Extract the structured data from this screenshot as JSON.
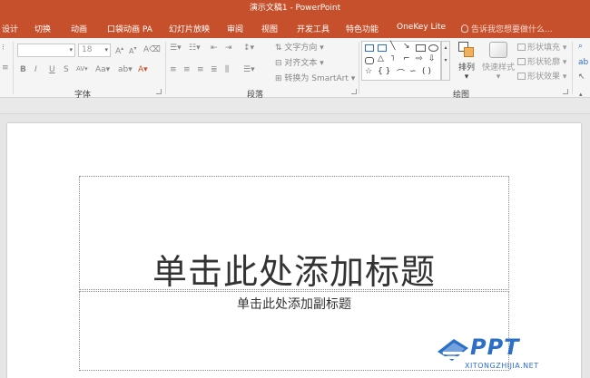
{
  "window": {
    "title": "演示文稿1 - PowerPoint"
  },
  "tabs": [
    {
      "label": "设计"
    },
    {
      "label": "切换"
    },
    {
      "label": "动画"
    },
    {
      "label": "口袋动画 PA"
    },
    {
      "label": "幻灯片放映"
    },
    {
      "label": "审阅"
    },
    {
      "label": "视图"
    },
    {
      "label": "开发工具"
    },
    {
      "label": "特色功能"
    },
    {
      "label": "OneKey Lite"
    }
  ],
  "tell_me": {
    "placeholder": "告诉我您想要做什么..."
  },
  "ribbon": {
    "font_group": {
      "label": "字体",
      "font_name": "",
      "font_size": "18",
      "grow_label": "A",
      "shrink_label": "A",
      "clear_format_label": "A",
      "bold": "B",
      "italic": "I",
      "underline": "U",
      "strike": "S",
      "spacing": "AV",
      "case": "Aa"
    },
    "paragraph_group": {
      "label": "段落",
      "text_direction": "文字方向",
      "align_text": "对齐文本",
      "convert_smartart": "转换为 SmartArt"
    },
    "drawing_group": {
      "label": "绘图",
      "arrange": "排列",
      "quick_styles": "快速样式",
      "shape_fill": "形状填充",
      "shape_outline": "形状轮廓",
      "shape_effects": "形状效果"
    }
  },
  "slide": {
    "title_placeholder": "单击此处添加标题",
    "subtitle_placeholder": "单击此处添加副标题"
  },
  "watermark": {
    "brand": "PPT",
    "url": "XITONGZHIJIA.NET"
  },
  "colors": {
    "accent": "#c6502b",
    "ribbon_bg": "#f5f5f5",
    "watermark_blue": "#2b6fc9"
  }
}
